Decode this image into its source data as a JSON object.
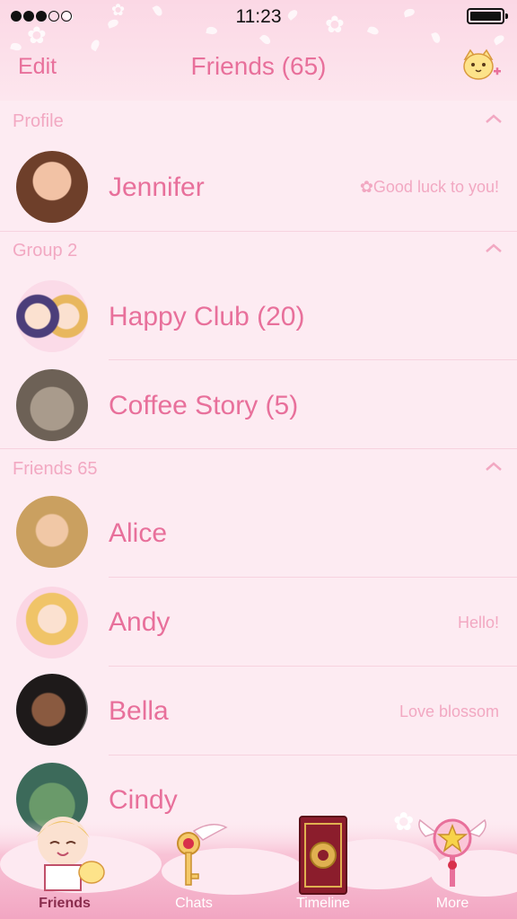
{
  "status_bar": {
    "time": "11:23",
    "signal_bars": 3,
    "signal_total": 5
  },
  "nav": {
    "edit_label": "Edit",
    "title": "Friends (65)",
    "add_icon": "add-friend-icon"
  },
  "sections": {
    "profile": {
      "label": "Profile"
    },
    "group": {
      "label": "Group 2"
    },
    "friends": {
      "label": "Friends 65"
    }
  },
  "profile": {
    "name": "Jennifer",
    "status": "Good luck to you!"
  },
  "groups": [
    {
      "name": "Happy Club (20)"
    },
    {
      "name": "Coffee Story (5)"
    }
  ],
  "friends": [
    {
      "name": "Alice",
      "status": ""
    },
    {
      "name": "Andy",
      "status": "Hello!"
    },
    {
      "name": "Bella",
      "status": "Love blossom"
    },
    {
      "name": "Cindy",
      "status": ""
    }
  ],
  "tabs": [
    {
      "label": "Friends",
      "icon": "friends-icon",
      "active": true
    },
    {
      "label": "Chats",
      "icon": "chats-icon",
      "active": false
    },
    {
      "label": "Timeline",
      "icon": "timeline-icon",
      "active": false
    },
    {
      "label": "More",
      "icon": "more-icon",
      "active": false
    }
  ],
  "colors": {
    "accent": "#e8709b",
    "muted": "#f2a8c2",
    "background": "#fdebf2"
  }
}
